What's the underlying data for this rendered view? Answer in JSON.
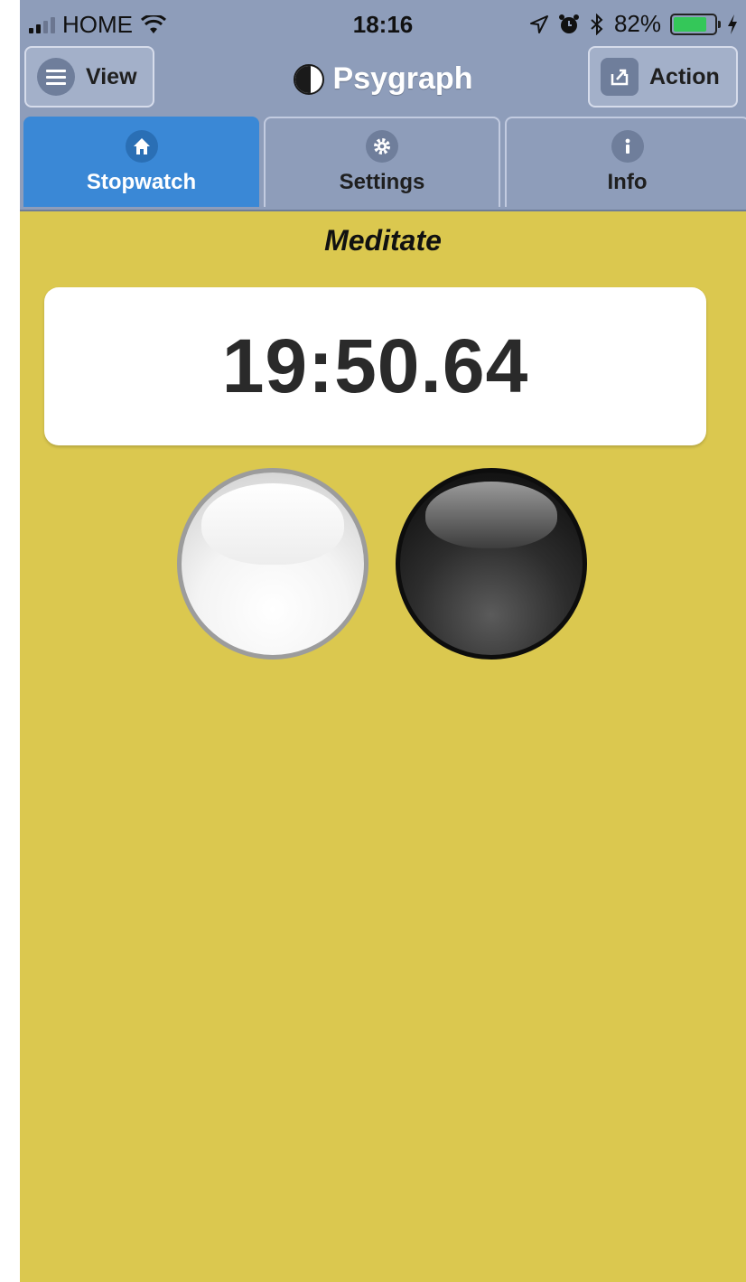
{
  "status_bar": {
    "carrier": "HOME",
    "time": "18:16",
    "battery_percent": "82%",
    "battery_level": 0.82,
    "icons": [
      "signal-icon",
      "wifi-icon",
      "location-arrow-icon",
      "alarm-icon",
      "bluetooth-icon",
      "battery-icon",
      "charging-bolt-icon"
    ]
  },
  "header": {
    "view_label": "View",
    "title": "Psygraph",
    "action_label": "Action"
  },
  "tabs": [
    {
      "label": "Stopwatch",
      "icon": "home-icon",
      "active": true
    },
    {
      "label": "Settings",
      "icon": "gear-icon",
      "active": false
    },
    {
      "label": "Info",
      "icon": "info-icon",
      "active": false
    }
  ],
  "main": {
    "subtitle": "Meditate",
    "timer": "19:50.64"
  },
  "colors": {
    "background": "#dbc84f",
    "header": "#8e9dba",
    "active_tab": "#3a88d6"
  }
}
